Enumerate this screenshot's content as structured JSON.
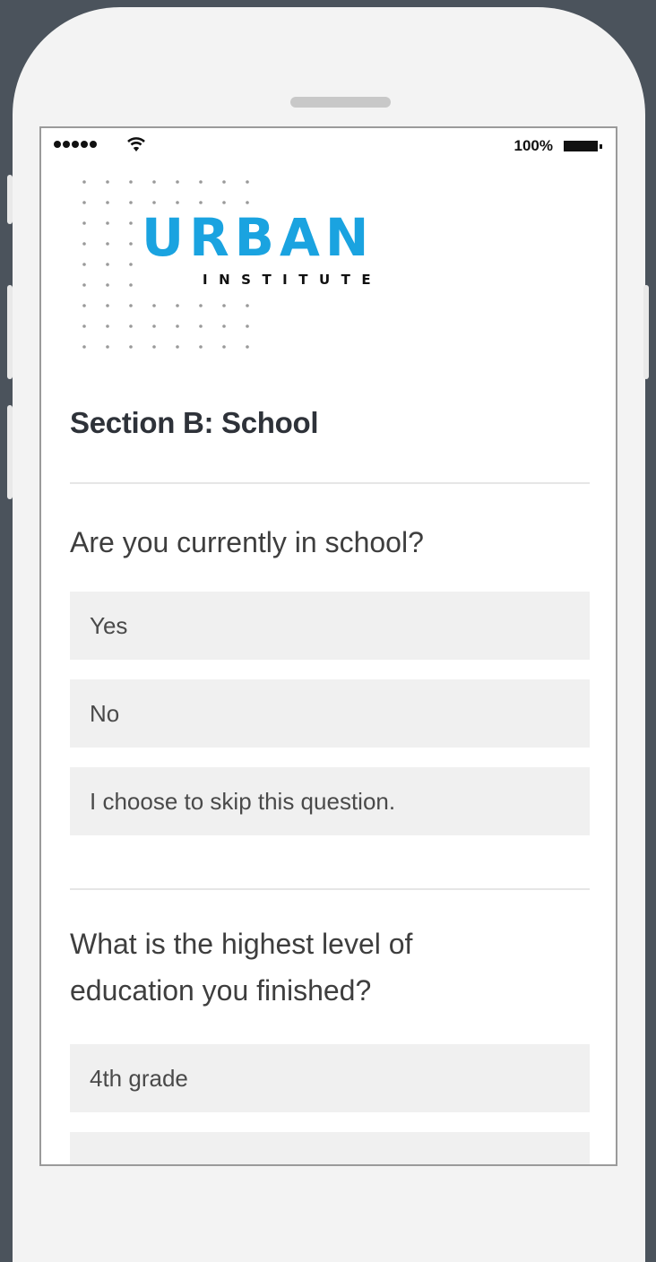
{
  "status_bar": {
    "battery_percent": "100%",
    "signal_bars": 5
  },
  "logo": {
    "word_main": "URBAN",
    "word_sub": "INSTITUTE",
    "brand_color": "#1aa3e0"
  },
  "form": {
    "section_title": "Section B: School",
    "questions": [
      {
        "text": "Are you currently in school?",
        "options": [
          "Yes",
          "No",
          "I choose to skip this question."
        ]
      },
      {
        "text_line1": "What is the highest level of",
        "text_line2": "education you finished?",
        "options": [
          "4th grade"
        ]
      }
    ]
  },
  "colors": {
    "background": "#4b535c",
    "phone_frame": "#f3f3f3",
    "option_fill": "#f0f0f0",
    "title_text": "#2e3239"
  }
}
